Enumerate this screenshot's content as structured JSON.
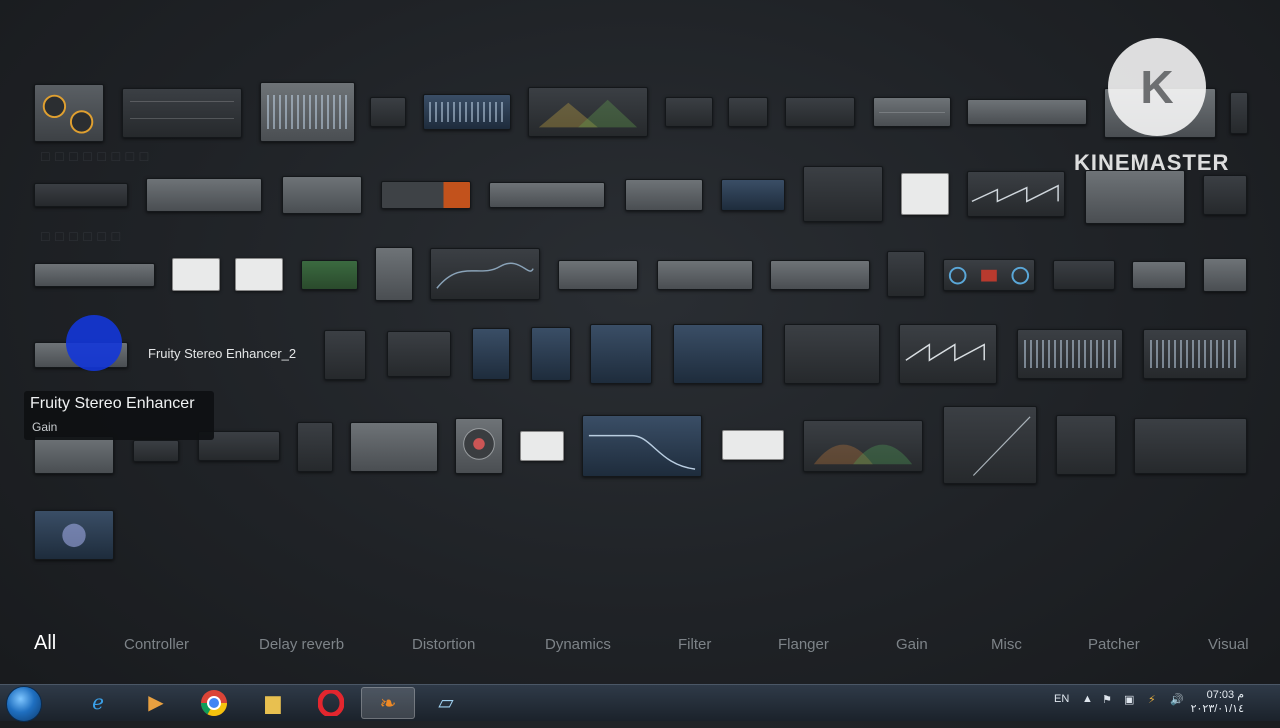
{
  "tooltip": {
    "title": "Fruity Stereo Enhancer",
    "subtitle": "Gain"
  },
  "hover_label": "Fruity Stereo Enhancer_2",
  "watermark": {
    "brand": "KINEMASTER",
    "logo_letter": "K"
  },
  "categories": [
    {
      "label": "All",
      "active": true
    },
    {
      "label": "Controller",
      "active": false
    },
    {
      "label": "Delay reverb",
      "active": false
    },
    {
      "label": "Distortion",
      "active": false
    },
    {
      "label": "Dynamics",
      "active": false
    },
    {
      "label": "Filter",
      "active": false
    },
    {
      "label": "Flanger",
      "active": false
    },
    {
      "label": "Gain",
      "active": false
    },
    {
      "label": "Misc",
      "active": false
    },
    {
      "label": "Patcher",
      "active": false
    },
    {
      "label": "Visual",
      "active": false
    }
  ],
  "taskbar": {
    "apps": [
      "start",
      "internet-explorer",
      "media-player",
      "chrome",
      "file-explorer",
      "opera",
      "fl-studio",
      "window-switch"
    ],
    "active_app": "fl-studio",
    "language": "EN",
    "time": "07:03 م",
    "date": "٢٠٢٣/٠١/١٤"
  },
  "colors": {
    "accent_blue": "#1336d8",
    "background": "#1f2226",
    "taskbar": "#1b222b"
  },
  "plugins_visible_count": 66
}
